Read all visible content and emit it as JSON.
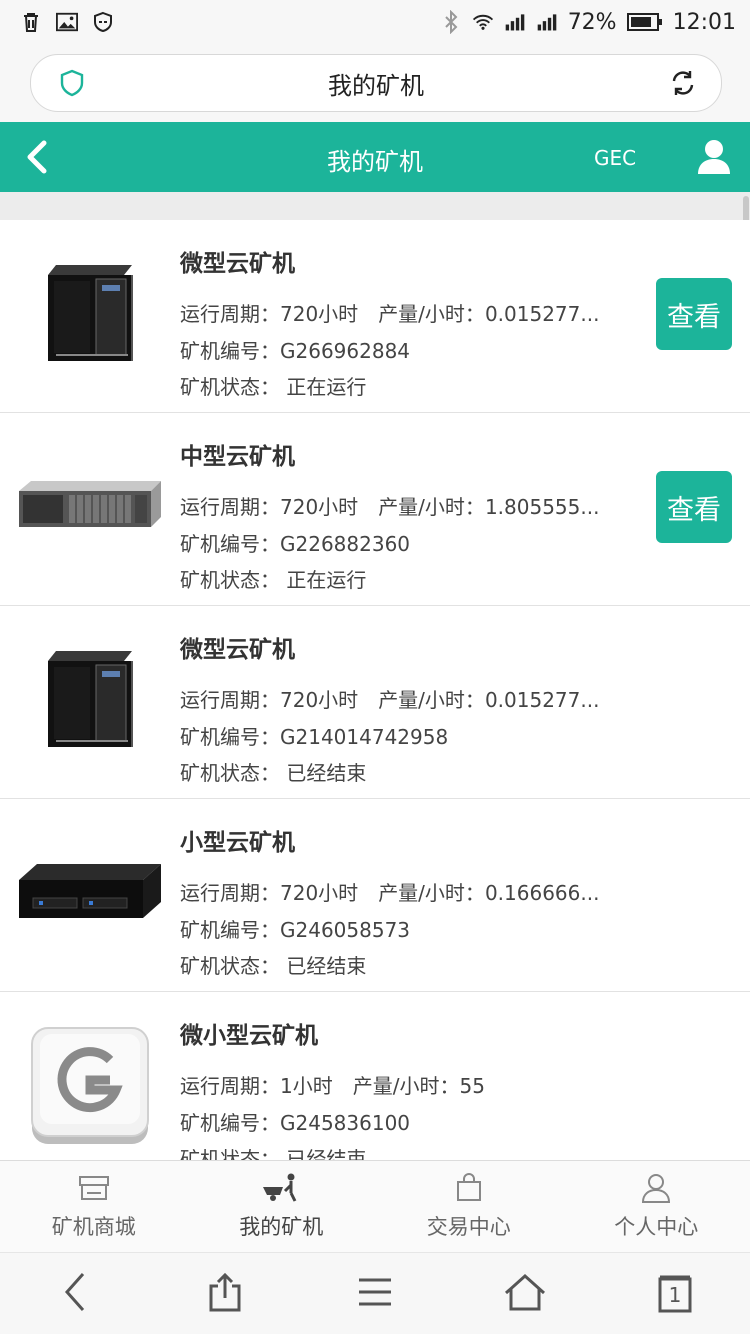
{
  "status": {
    "battery": "72%",
    "time": "12:01"
  },
  "url": {
    "title": "我的矿机"
  },
  "header": {
    "title": "我的矿机",
    "gec": "GEC"
  },
  "labels": {
    "cycle": "运行周期：",
    "output": "产量/小时：",
    "serial": "矿机编号：",
    "state": "矿机状态：",
    "view": "查看"
  },
  "items": [
    {
      "name": "微型云矿机",
      "cycle": "720小时",
      "output": "0.015277...",
      "serial": "G266962884",
      "state": "正在运行",
      "show_view": true,
      "image": "mini-tower-server"
    },
    {
      "name": "中型云矿机",
      "cycle": "720小时",
      "output": "1.805555...",
      "serial": "G226882360",
      "state": "正在运行",
      "show_view": true,
      "image": "rack-server"
    },
    {
      "name": "微型云矿机",
      "cycle": "720小时",
      "output": "0.015277...",
      "serial": "G214014742958",
      "state": "已经结束",
      "show_view": false,
      "image": "mini-tower-server"
    },
    {
      "name": "小型云矿机",
      "cycle": "720小时",
      "output": "0.166666...",
      "serial": "G246058573",
      "state": "已经结束",
      "show_view": false,
      "image": "desktop-server"
    },
    {
      "name": "微小型云矿机",
      "cycle": "1小时",
      "output": "55",
      "serial": "G245836100",
      "state": "已经结束",
      "show_view": false,
      "image": "g-key-icon"
    }
  ],
  "tabbar": [
    {
      "label": "矿机商城",
      "icon": "shop-icon"
    },
    {
      "label": "我的矿机",
      "icon": "miner-cart-icon"
    },
    {
      "label": "交易中心",
      "icon": "bag-icon"
    },
    {
      "label": "个人中心",
      "icon": "person-icon"
    }
  ],
  "browser_nav": {
    "tabs_count": "1"
  },
  "colors": {
    "accent": "#1cb49a"
  }
}
